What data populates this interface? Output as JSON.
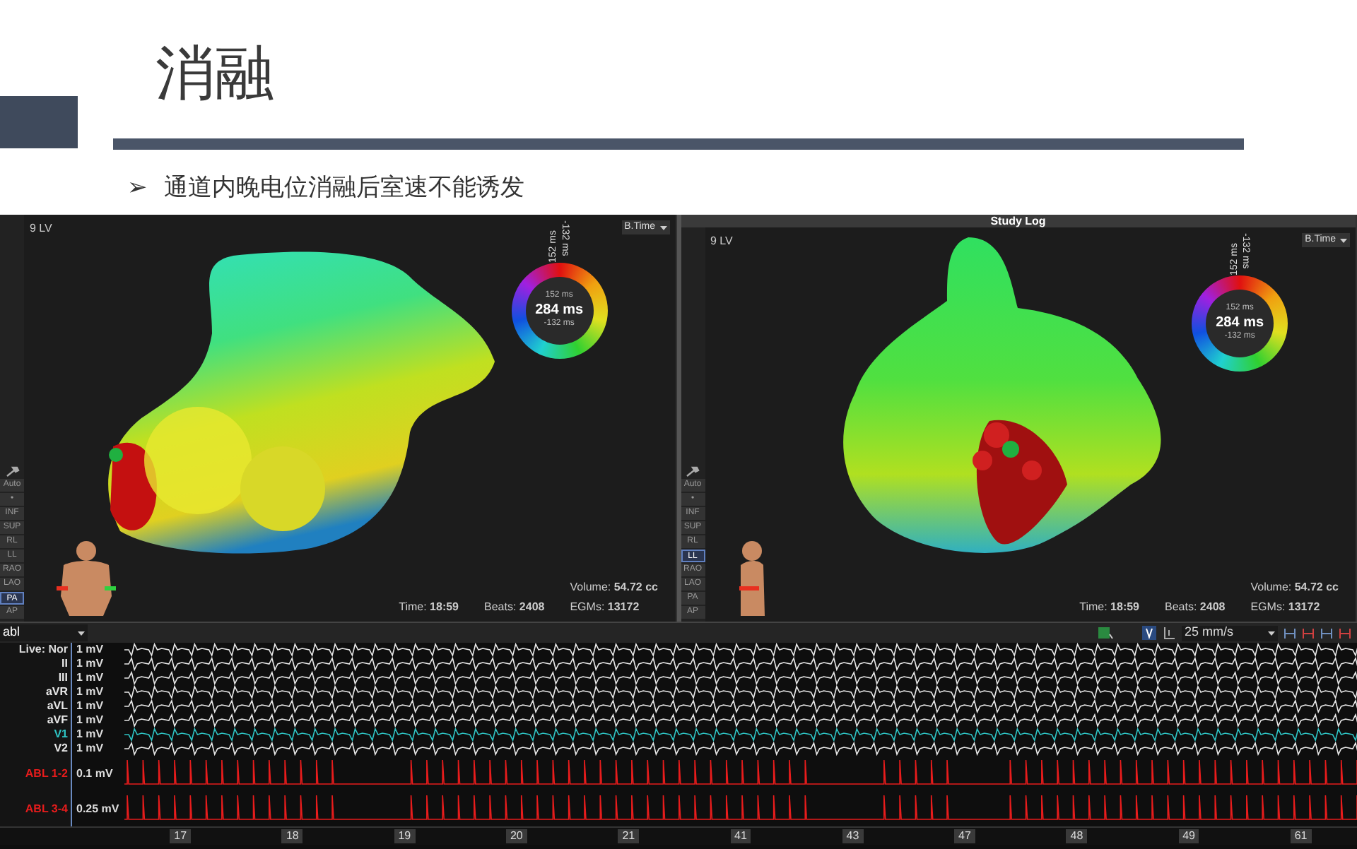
{
  "slide": {
    "title": "消融",
    "bullet": {
      "marker": "➢",
      "text": "通道内晚电位消融后室速不能诱发"
    }
  },
  "map_panels": [
    {
      "label": "9 LV",
      "dropdown": "B.Time",
      "ring": {
        "top_max": "152 ms",
        "top_min": "-132 ms",
        "max": "152 ms",
        "center": "284 ms",
        "min": "-132 ms"
      },
      "view_buttons": [
        {
          "label": "Auto",
          "selected": false
        },
        {
          "label": "•",
          "selected": false
        },
        {
          "label": "INF",
          "selected": false
        },
        {
          "label": "SUP",
          "selected": false
        },
        {
          "label": "RL",
          "selected": false
        },
        {
          "label": "LL",
          "selected": false
        },
        {
          "label": "RAO",
          "selected": false
        },
        {
          "label": "LAO",
          "selected": false
        },
        {
          "label": "PA",
          "selected": true
        },
        {
          "label": "AP",
          "selected": false
        }
      ],
      "stats": {
        "volume": "Volume: **54.72 cc**",
        "time": "Time: **18:59**",
        "beats": "Beats: **2408**",
        "egms": "EGMs: **13172**"
      },
      "kind": "posterior"
    },
    {
      "header": "Study Log",
      "label": "9 LV",
      "dropdown": "B.Time",
      "ring": {
        "top_max": "152 ms",
        "top_min": "-132 ms",
        "max": "152 ms",
        "center": "284 ms",
        "min": "-132 ms"
      },
      "view_buttons": [
        {
          "label": "Auto",
          "selected": false
        },
        {
          "label": "•",
          "selected": false
        },
        {
          "label": "INF",
          "selected": false
        },
        {
          "label": "SUP",
          "selected": false
        },
        {
          "label": "RL",
          "selected": false
        },
        {
          "label": "LL",
          "selected": true
        },
        {
          "label": "RAO",
          "selected": false
        },
        {
          "label": "LAO",
          "selected": false
        },
        {
          "label": "PA",
          "selected": false
        },
        {
          "label": "AP",
          "selected": false
        }
      ],
      "stats": {
        "volume": "Volume: **54.72 cc**",
        "time": "Time: **18:59**",
        "beats": "Beats: **2408**",
        "egms": "EGMs: **13172**"
      },
      "kind": "lateral"
    }
  ],
  "ecg": {
    "source": "abl",
    "live": "Live: Nor",
    "speed": "25 mm/s",
    "channels": [
      {
        "scale": "1 mV",
        "kind": "surface",
        "color": "#e8e8e8"
      },
      {
        "name": "II",
        "scale": "1 mV",
        "kind": "surface",
        "color": "#e8e8e8"
      },
      {
        "name": "III",
        "scale": "1 mV",
        "kind": "surface",
        "color": "#e8e8e8"
      },
      {
        "name": "aVR",
        "scale": "1 mV",
        "kind": "surface",
        "color": "#e8e8e8"
      },
      {
        "name": "aVL",
        "scale": "1 mV",
        "kind": "surface",
        "color": "#e8e8e8"
      },
      {
        "name": "aVF",
        "scale": "1 mV",
        "kind": "surface",
        "color": "#e8e8e8"
      },
      {
        "name": "V1",
        "scale": "1 mV",
        "kind": "surface",
        "color": "#2ec4c4"
      },
      {
        "name": "V2",
        "scale": "1 mV",
        "kind": "surface",
        "color": "#e8e8e8"
      },
      {
        "name": "ABL 1-2",
        "scale": "0.1 mV",
        "kind": "ablation",
        "color": "#e81c1c"
      },
      {
        "name": "ABL 3-4",
        "scale": "0.25 mV",
        "kind": "ablation",
        "color": "#e81c1c"
      }
    ],
    "beat_numbers": [
      "17",
      "18",
      "19",
      "20",
      "21",
      "41",
      "43",
      "47",
      "48",
      "49",
      "61"
    ]
  }
}
